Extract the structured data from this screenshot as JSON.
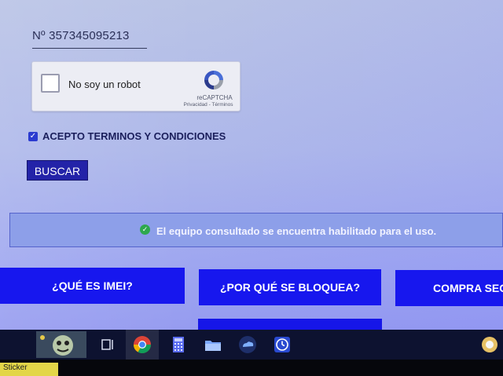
{
  "imei_field": {
    "value": "Nº 357345095213"
  },
  "recaptcha": {
    "label": "No soy un robot",
    "brand": "reCAPTCHA",
    "links": "Privacidad - Términos"
  },
  "terms": {
    "label": "ACEPTO TERMINOS Y CONDICIONES",
    "checked": true
  },
  "search_button": {
    "label": "BUSCAR"
  },
  "status": {
    "message": "El equipo consultado se encuentra habilitado para el uso.",
    "color": "#2ea84d"
  },
  "info_buttons": [
    {
      "label": "¿QUÉ ES IMEI?"
    },
    {
      "label": "¿POR QUÉ SE BLOQUEA?"
    },
    {
      "label": "COMPRA SEG"
    }
  ],
  "taskbar": {
    "items": [
      "mascot-icon",
      "task-view-icon",
      "chrome-icon",
      "calculator-icon",
      "file-explorer-icon",
      "cloud-app-icon",
      "clock-app-icon",
      "tray-app-icon"
    ]
  },
  "sticker": {
    "text": "Sticker"
  },
  "colors": {
    "accent": "#1717ee",
    "button_dark": "#2323a8",
    "taskbar": "#0d1230"
  }
}
